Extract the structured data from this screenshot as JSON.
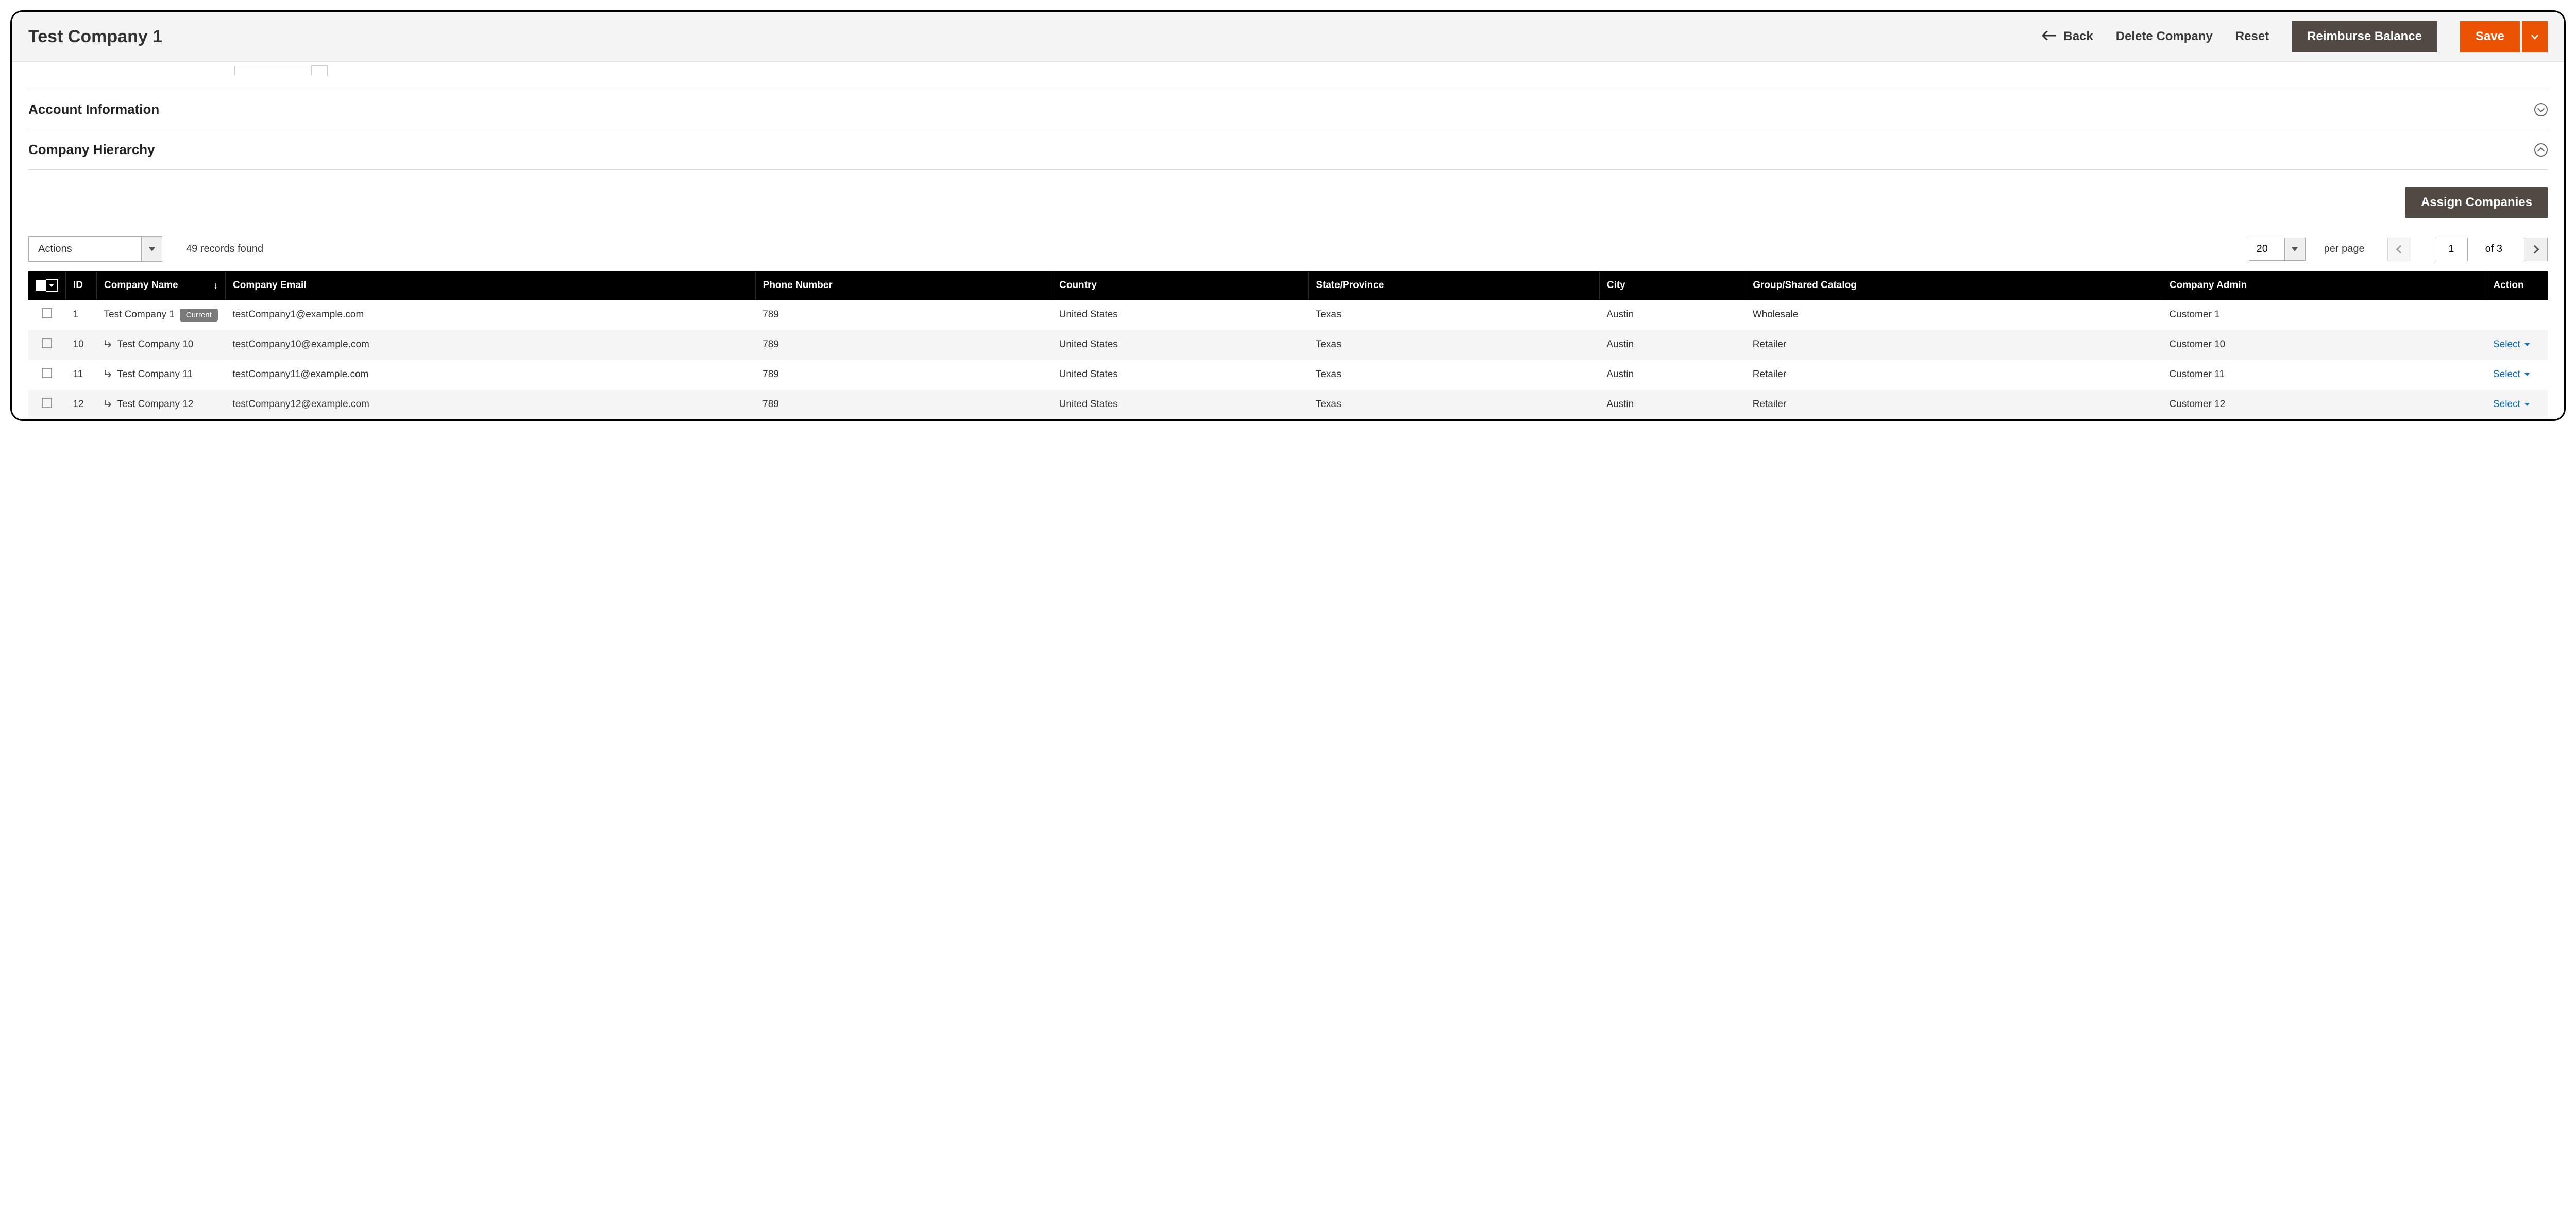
{
  "header": {
    "title": "Test Company 1",
    "back": "Back",
    "delete": "Delete Company",
    "reset": "Reset",
    "reimburse": "Reimburse Balance",
    "save": "Save"
  },
  "sections": {
    "account_info": "Account Information",
    "company_hierarchy": "Company Hierarchy"
  },
  "hierarchy": {
    "assign_button": "Assign Companies",
    "actions_label": "Actions",
    "records_found": "49 records found",
    "page_size": "20",
    "per_page_label": "per page",
    "current_page": "1",
    "page_of": "of 3",
    "columns": {
      "id": "ID",
      "company_name": "Company Name",
      "company_email": "Company Email",
      "phone": "Phone Number",
      "country": "Country",
      "state": "State/Province",
      "city": "City",
      "group": "Group/Shared Catalog",
      "admin": "Company Admin",
      "action": "Action"
    },
    "current_badge": "Current",
    "select_label": "Select",
    "rows": [
      {
        "id": "1",
        "name": "Test Company 1",
        "child": false,
        "current": true,
        "email": "testCompany1@example.com",
        "phone": "789",
        "country": "United States",
        "state": "Texas",
        "city": "Austin",
        "group": "Wholesale",
        "admin": "Customer 1",
        "action": false
      },
      {
        "id": "10",
        "name": "Test Company 10",
        "child": true,
        "current": false,
        "email": "testCompany10@example.com",
        "phone": "789",
        "country": "United States",
        "state": "Texas",
        "city": "Austin",
        "group": "Retailer",
        "admin": "Customer 10",
        "action": true
      },
      {
        "id": "11",
        "name": "Test Company 11",
        "child": true,
        "current": false,
        "email": "testCompany11@example.com",
        "phone": "789",
        "country": "United States",
        "state": "Texas",
        "city": "Austin",
        "group": "Retailer",
        "admin": "Customer 11",
        "action": true
      },
      {
        "id": "12",
        "name": "Test Company 12",
        "child": true,
        "current": false,
        "email": "testCompany12@example.com",
        "phone": "789",
        "country": "United States",
        "state": "Texas",
        "city": "Austin",
        "group": "Retailer",
        "admin": "Customer 12",
        "action": true
      }
    ]
  }
}
